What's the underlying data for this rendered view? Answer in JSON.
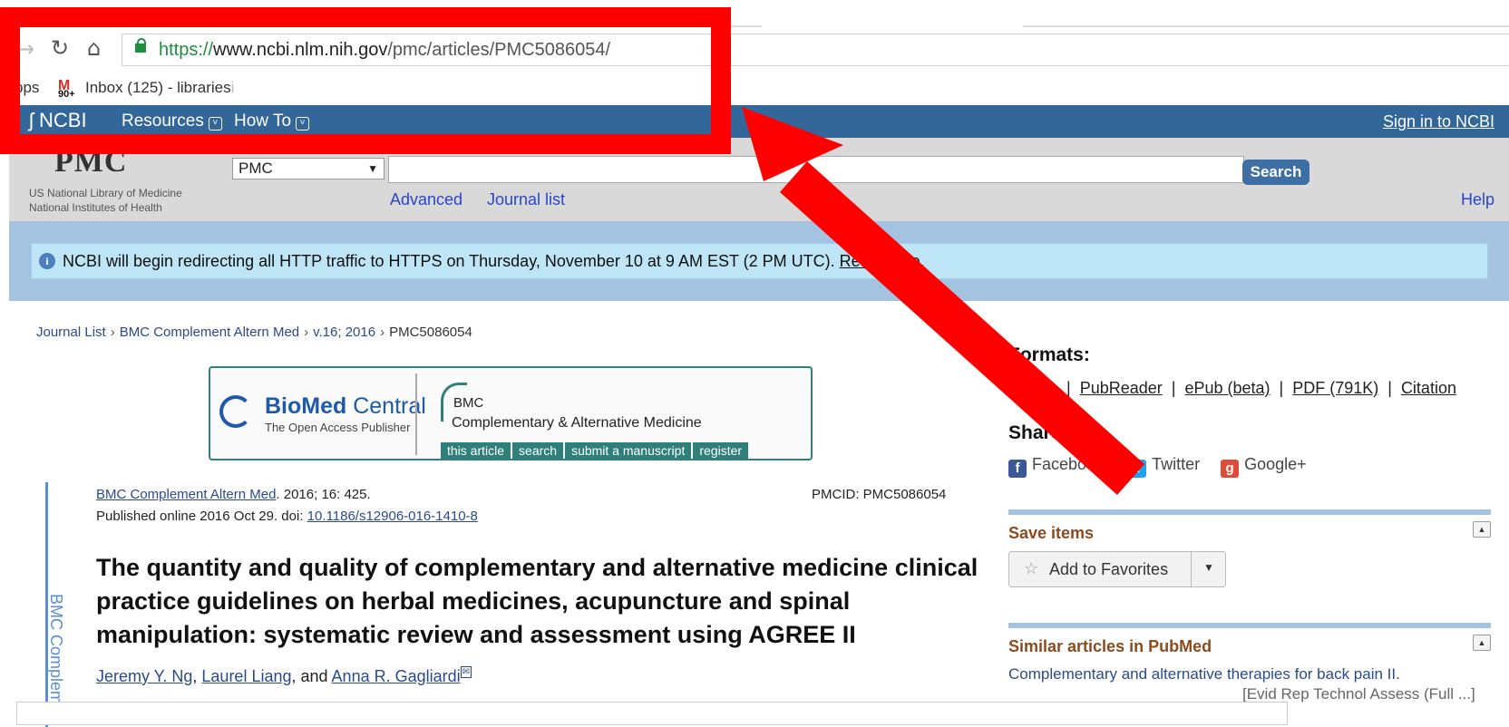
{
  "browser": {
    "url_scheme": "https://",
    "url_domain": "www.ncbi.nlm.nih.gov",
    "url_path": "/pmc/articles/PMC5086054/",
    "bookmarks": [
      {
        "label": "pps"
      },
      {
        "badge": "90+",
        "label": "Inbox (125) - libraries",
        "fade": "i"
      }
    ]
  },
  "ncbi_bar": {
    "logo": "NCBI",
    "resources": "Resources",
    "how_to": "How To",
    "sign_in": "Sign in to NCBI"
  },
  "pmc_header": {
    "logo": "PMC",
    "nlm_line1": "US National Library of Medicine",
    "nlm_line2": "National Institutes of Health",
    "db_selected": "PMC",
    "search_value": "",
    "search_button": "Search",
    "advanced": "Advanced",
    "journal_list": "Journal list",
    "help": "Help"
  },
  "banner": {
    "text": "NCBI will begin redirecting all HTTP traffic to HTTPS on Thursday, November 10 at 9 AM EST (2 PM UTC).",
    "link": "Read more."
  },
  "breadcrumb": {
    "items": [
      "Journal List",
      "BMC Complement Altern Med",
      "v.16; 2016"
    ],
    "current": "PMC5086054"
  },
  "journal_banner": {
    "bio": "BioMed",
    "central": " Central",
    "tagline": "The Open Access Publisher",
    "bmc": "BMC",
    "journal": "Complementary & Alternative Medicine",
    "tabs": [
      "this article",
      "search",
      "submit a manuscript",
      "register"
    ]
  },
  "sidebar_vertical": "BMC Complem",
  "article": {
    "journal_link": "BMC Complement Altern Med",
    "citation_rest": ". 2016; 16: 425.",
    "pmcid": "PMCID: PMC5086054",
    "published_prefix": "Published online 2016 Oct 29. doi: ",
    "doi": "10.1186/s12906-016-1410-8",
    "title": "The quantity and quality of complementary and alternative medicine clinical practice guidelines on herbal medicines, acupuncture and spinal manipulation: systematic review and assessment using AGREE II",
    "authors": [
      "Jeremy Y. Ng",
      "Laurel Liang",
      "Anna R. Gagliardi"
    ],
    "author_sep1": ", ",
    "author_sep2": ", and "
  },
  "right_column": {
    "formats_title": "Formats:",
    "formats": [
      "Article",
      "PubReader",
      "ePub (beta)",
      "PDF (791K)",
      "Citation"
    ],
    "share_title": "Share",
    "share": [
      "Facebook",
      "Twitter",
      "Google+"
    ],
    "save_items": "Save items",
    "add_favorites": "Add to Favorites",
    "similar_title": "Similar articles in PubMed",
    "similar_item": "Complementary and alternative therapies for back pain II.",
    "similar_source": "[Evid Rep Technol Assess (Full ...]"
  },
  "colors": {
    "ncbi_blue": "#336699",
    "annotation_red": "#ff0000",
    "portlet_title": "#8a4b1e"
  }
}
